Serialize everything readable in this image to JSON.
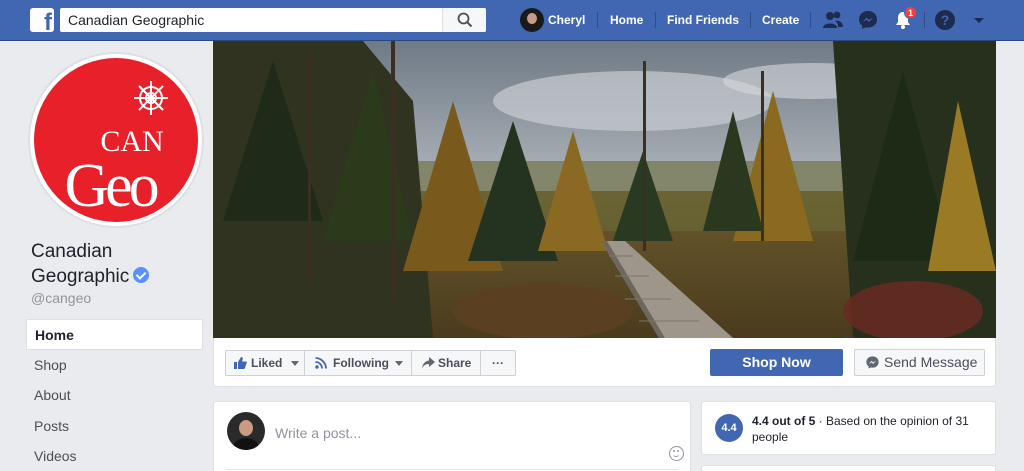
{
  "topbar": {
    "search_value": "Canadian Geographic",
    "user_name": "Cheryl",
    "links": [
      "Home",
      "Find Friends",
      "Create"
    ],
    "notification_count": "1",
    "icons": [
      "facebook-logo-icon",
      "search-icon",
      "friend-requests-icon",
      "messenger-icon",
      "notifications-icon",
      "help-icon",
      "account-menu-caret-icon"
    ]
  },
  "page": {
    "name": "Canadian Geographic",
    "handle": "@cangeo",
    "logo_text_top": "CAN",
    "logo_text_bottom": "Geo",
    "nav": [
      "Home",
      "Shop",
      "About",
      "Posts",
      "Videos"
    ],
    "active_nav": "Home"
  },
  "actions": {
    "liked": "Liked",
    "following": "Following",
    "share": "Share",
    "more": "···",
    "shop_now": "Shop Now",
    "send_message": "Send Message"
  },
  "composer": {
    "placeholder": "Write a post..."
  },
  "rating": {
    "score": "4.4",
    "score_text": "4.4 out of 5",
    "detail": " · Based on the opinion of 31 people"
  },
  "colors": {
    "brand": "#4267b2",
    "logo_red": "#e8202a",
    "badge": "#fa3e3e"
  }
}
